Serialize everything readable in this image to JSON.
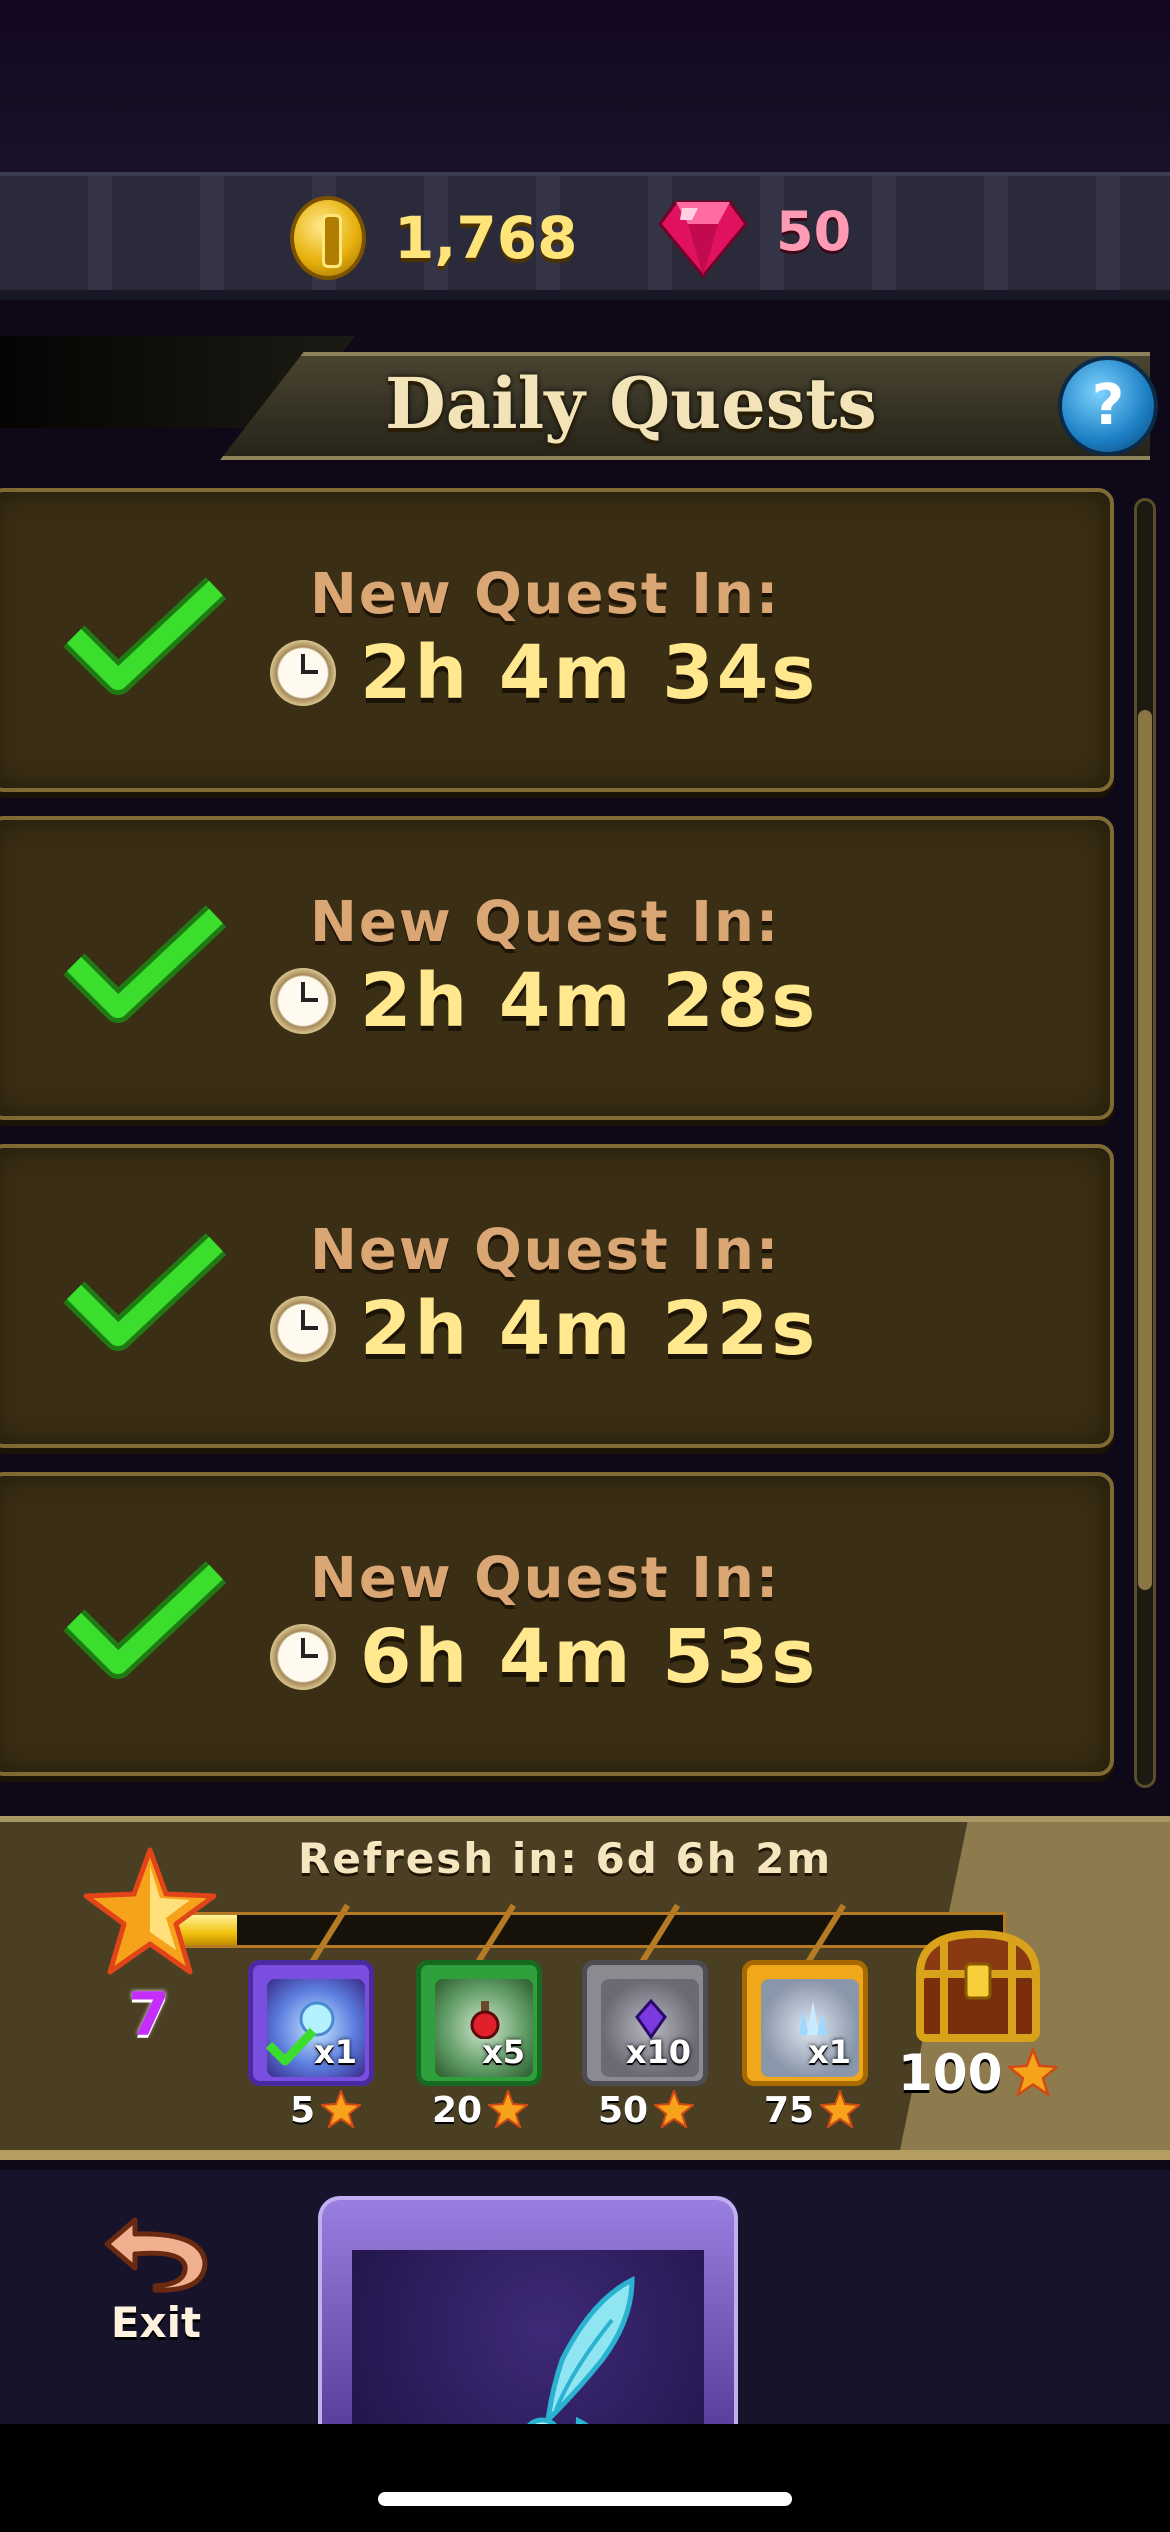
{
  "currency": {
    "coins": "1,768",
    "gems": "50"
  },
  "header": {
    "title": "Daily Quests",
    "help_symbol": "?"
  },
  "quests": [
    {
      "label": "New Quest In:",
      "timer": "2h 4m 34s",
      "completed": true
    },
    {
      "label": "New Quest In:",
      "timer": "2h 4m 28s",
      "completed": true
    },
    {
      "label": "New Quest In:",
      "timer": "2h 4m 22s",
      "completed": true
    },
    {
      "label": "New Quest In:",
      "timer": "6h 4m 53s",
      "completed": true
    }
  ],
  "progress": {
    "refresh_text": "Refresh in: 6d 6h 2m",
    "stars": "7",
    "fill_fraction": 0.07,
    "rewards": [
      {
        "icon": "orb-reward-icon",
        "qty": "x1",
        "cost": "5",
        "claimed": true,
        "frame": "#7a4fe0"
      },
      {
        "icon": "potion-reward-icon",
        "qty": "x5",
        "cost": "20",
        "claimed": false,
        "frame": "#2fa03c"
      },
      {
        "icon": "crystal-reward-icon",
        "qty": "x10",
        "cost": "50",
        "claimed": false,
        "frame": "#8a8a90"
      },
      {
        "icon": "crystal-cluster-reward-icon",
        "qty": "x1",
        "cost": "75",
        "claimed": false,
        "frame": "#f1a71a"
      }
    ],
    "chest_cost": "100"
  },
  "footer": {
    "exit_label": "Exit"
  },
  "colors": {
    "check": "#3bde2c",
    "quest_label": "#d9a674",
    "quest_timer": "#ffe88d",
    "stars": "#c52dfc"
  }
}
